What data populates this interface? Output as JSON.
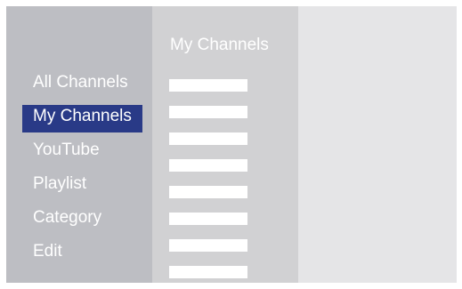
{
  "menu": {
    "items": [
      {
        "label": "All Channels"
      },
      {
        "label": "My Channels",
        "selected": true
      },
      {
        "label": "YouTube"
      },
      {
        "label": "Playlist"
      },
      {
        "label": "Category"
      },
      {
        "label": "Edit"
      }
    ]
  },
  "channels": {
    "title": "My Channels",
    "row_count": 8
  },
  "colors": {
    "menu_bg": "#bdbec3",
    "channels_bg": "#d1d1d3",
    "detail_bg": "#e5e5e7",
    "selected_accent": "#293a87",
    "text": "#ffffff"
  }
}
